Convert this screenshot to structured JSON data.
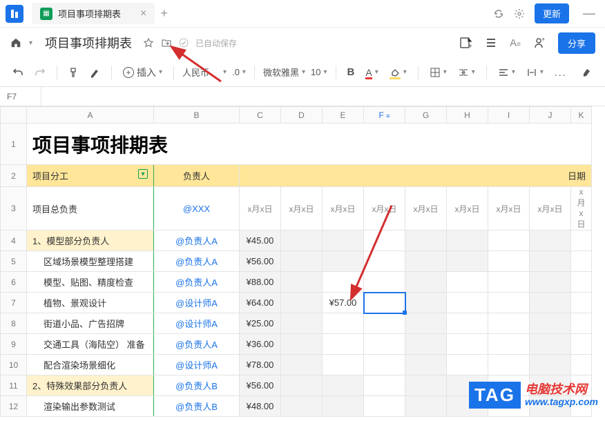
{
  "titlebar": {
    "tab_title": "项目事项排期表",
    "update_label": "更新"
  },
  "header": {
    "doc_title": "项目事项排期表",
    "autosave": "已自动保存",
    "share_label": "分享"
  },
  "toolbar": {
    "insert_label": "插入",
    "number_format": "人民币",
    "decimal": ".0",
    "font_name": "微软雅黑",
    "font_size": "10",
    "bold": "B",
    "text_a": "A",
    "more": "..."
  },
  "refbar": {
    "cell": "F7"
  },
  "columns": [
    "A",
    "B",
    "C",
    "D",
    "E",
    "F",
    "G",
    "H",
    "I",
    "J",
    "K"
  ],
  "sheet_title": "项目事项排期表",
  "table_header": {
    "col_a": "项目分工",
    "col_b": "负责人",
    "date_label": "日期"
  },
  "date_placeholder": "x月x日",
  "rows": [
    {
      "n": 3,
      "a": "项目总负责",
      "b": "@XXX",
      "c": "",
      "subhead": false,
      "greyE": false
    },
    {
      "n": 4,
      "a": "1、模型部分负责人",
      "b": "@负责人A",
      "c": "¥45.00",
      "subhead": true,
      "greyE": true
    },
    {
      "n": 5,
      "a": "区域场景模型整理搭建",
      "b": "@负责人A",
      "c": "¥56.00",
      "indent": true,
      "greyE": true
    },
    {
      "n": 6,
      "a": "模型、贴图、精度检查",
      "b": "@负责人A",
      "c": "¥88.00",
      "indent": true
    },
    {
      "n": 7,
      "a": "植物、景观设计",
      "b": "@设计师A",
      "c": "¥64.00",
      "indent": true,
      "e": "¥57.00",
      "active": true
    },
    {
      "n": 8,
      "a": "街道小品、广告招牌",
      "b": "@设计师A",
      "c": "¥25.00",
      "indent": true
    },
    {
      "n": 9,
      "a": "交通工具（海陆空） 准备",
      "b": "@负责人A",
      "c": "¥36.00",
      "indent": true
    },
    {
      "n": 10,
      "a": "配合渲染场景细化",
      "b": "@设计师A",
      "c": "¥78.00",
      "indent": true
    },
    {
      "n": 11,
      "a": "2、特殊效果部分负责人",
      "b": "@负责人B",
      "c": "¥56.00",
      "subhead": true,
      "greyE": true
    },
    {
      "n": 12,
      "a": "渲染输出参数测试",
      "b": "@负责人B",
      "c": "¥48.00",
      "indent": true,
      "greyE": true
    }
  ],
  "watermark": {
    "tag": "TAG",
    "cn": "电脑技术网",
    "en": "www.tagxp.com"
  }
}
